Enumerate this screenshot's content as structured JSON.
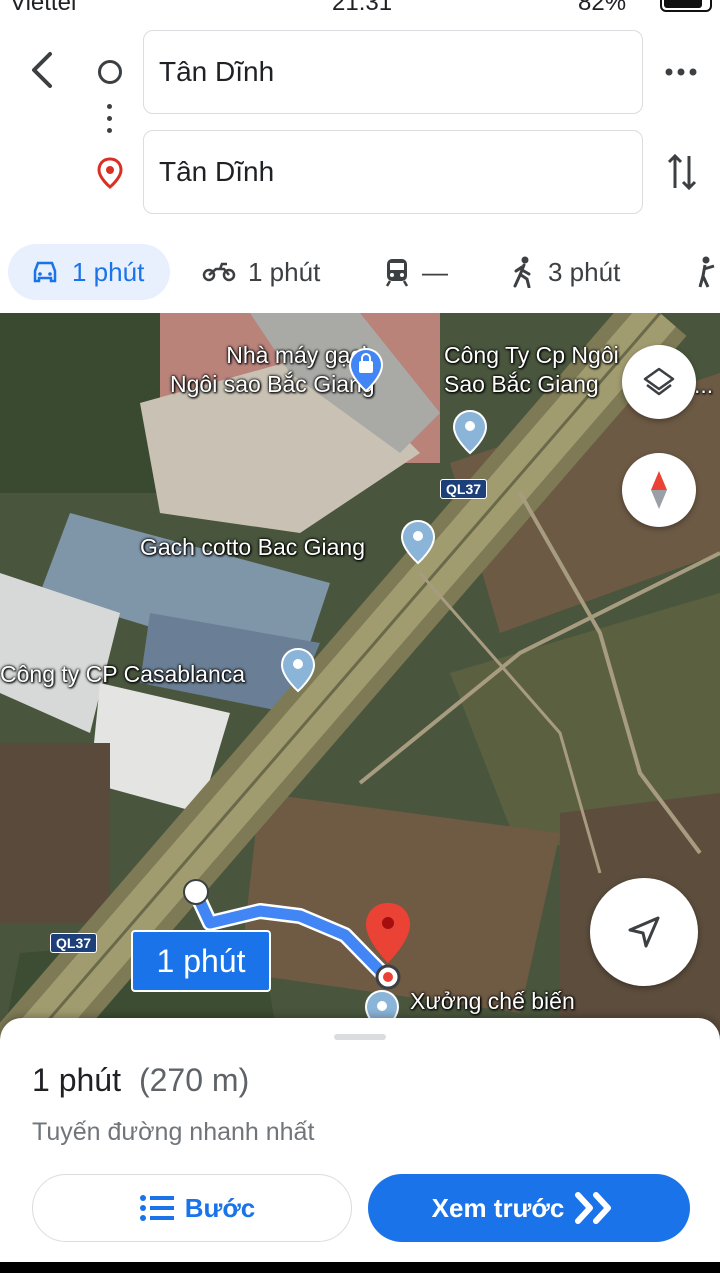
{
  "status_bar": {
    "carrier": "Viettel",
    "time": "21:31",
    "battery": "82%"
  },
  "search": {
    "origin": "Tân Dĩnh",
    "destination": "Tân Dĩnh"
  },
  "modes": [
    {
      "name": "car",
      "label": "1 phút",
      "active": true
    },
    {
      "name": "motorbike",
      "label": "1 phút"
    },
    {
      "name": "transit",
      "label": "—"
    },
    {
      "name": "walk",
      "label": "3 phút"
    }
  ],
  "map": {
    "poi_labels": {
      "factory": "Nhà máy gạch\nNgôi sao Bắc Giang",
      "company": "Công Ty Cp Ngôi\nSao Bắc Giang",
      "cotto": "Gach cotto Bac Giang",
      "casablanca": "Công ty CP Casablanca",
      "workshop": "Xưởng chế biến"
    },
    "road_shields": [
      "QL37",
      "QL37"
    ],
    "route_eta": "1 phút",
    "company_ellipsis": "..."
  },
  "sheet": {
    "time": "1 phút",
    "distance": "(270 m)",
    "subtitle": "Tuyến đường nhanh nhất",
    "steps_label": "Bước",
    "preview_label": "Xem trước"
  },
  "colors": {
    "accent": "#1a73e8",
    "accent_bg": "#e8f0fe",
    "pin_red": "#d93025"
  }
}
